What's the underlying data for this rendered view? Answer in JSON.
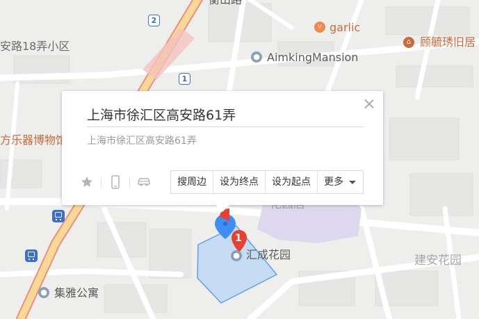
{
  "map": {
    "labels": {
      "top_road": "衡山路",
      "lane_18": "安路18弄小区",
      "museum": "方乐器博物馆",
      "garlic": "garlic",
      "gu_residence": "顾毓琇旧居",
      "aiming_mansion": "AimkingMansion",
      "garden_behind_popup": "花园居",
      "huicheng_garden": "汇成花园",
      "jianan_garden": "建安花园",
      "jiya_apartment": "集雅公寓"
    },
    "route_shields": [
      "2",
      "1"
    ],
    "poi_icons": [
      "restaurant-icon",
      "museum-icon",
      "place-icon",
      "place-icon",
      "place-icon"
    ],
    "colors": {
      "background": "#eeeeec",
      "main_road_fill": "#f7d897",
      "main_road_edge": "#ec8f7b",
      "selected_area": "#b7d6f6",
      "selected_area_border": "#5da0e6",
      "pin_blue": "#3d8ef0",
      "pin_red": "#e8412f",
      "purple_area": "#ded8ee",
      "bus_blue": "#3a6fd0"
    }
  },
  "marker": {
    "number": "1"
  },
  "popup": {
    "title": "上海市徐汇区高安路61弄",
    "address": "上海市徐汇区高安路61弄",
    "icons": [
      "star-icon",
      "phone-icon",
      "car-icon"
    ],
    "actions": [
      "搜周边",
      "设为终点",
      "设为起点"
    ],
    "more_label": "更多"
  }
}
